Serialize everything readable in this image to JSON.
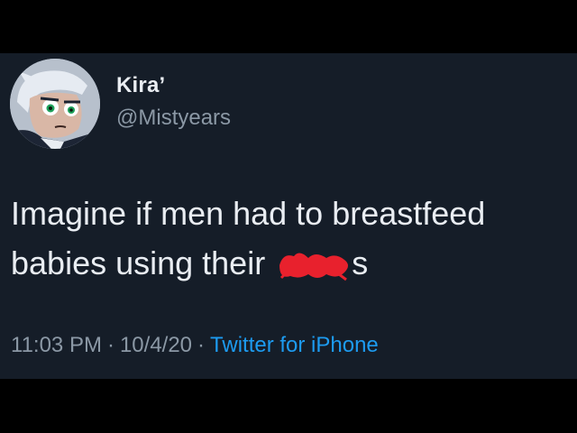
{
  "user": {
    "display_name": "Kira’",
    "handle": "@Mistyears",
    "avatar_icon": "cartoon-avatar-icon"
  },
  "tweet": {
    "line1": "Imagine if men had to breastfeed",
    "line2_prefix": "babies using their",
    "line2_suffix": "s",
    "redaction_color": "#e8212d"
  },
  "meta": {
    "time": "11:03 PM",
    "separator": "·",
    "date": "10/4/20",
    "source": "Twitter for iPhone"
  },
  "colors": {
    "background": "#151d28",
    "letterbox": "#000000",
    "primary_text": "#e9edf2",
    "secondary_text": "#8b98a5",
    "link": "#1d9bf0"
  }
}
